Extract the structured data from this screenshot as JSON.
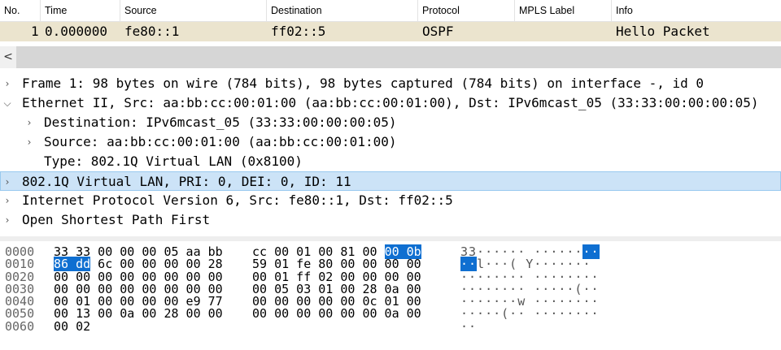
{
  "packet_list": {
    "columns": [
      "No.",
      "Time",
      "Source",
      "Destination",
      "Protocol",
      "MPLS Label",
      "Info"
    ],
    "rows": [
      {
        "no": "1",
        "time": "0.000000",
        "source": "fe80::1",
        "destination": "ff02::5",
        "protocol": "OSPF",
        "mpls_label": "",
        "info": "Hello Packet"
      }
    ]
  },
  "scrollbar": {
    "left_arrow": "<"
  },
  "details": [
    {
      "toggle": ">",
      "text": "Frame 1: 98 bytes on wire (784 bits), 98 bytes captured (784 bits) on interface -, id 0"
    },
    {
      "toggle": "v",
      "text": "Ethernet II, Src: aa:bb:cc:00:01:00 (aa:bb:cc:00:01:00), Dst: IPv6mcast_05 (33:33:00:00:00:05)"
    },
    {
      "toggle": ">",
      "text": "Destination: IPv6mcast_05 (33:33:00:00:00:05)"
    },
    {
      "toggle": ">",
      "text": "Source: aa:bb:cc:00:01:00 (aa:bb:cc:00:01:00)"
    },
    {
      "toggle": "",
      "text": "Type: 802.1Q Virtual LAN (0x8100)"
    },
    {
      "toggle": ">",
      "text": "802.1Q Virtual LAN, PRI: 0, DEI: 0, ID: 11"
    },
    {
      "toggle": ">",
      "text": "Internet Protocol Version 6, Src: fe80::1, Dst: ff02::5"
    },
    {
      "toggle": ">",
      "text": "Open Shortest Path First"
    }
  ],
  "bytes": [
    {
      "offset": "0000",
      "hex_a": "33 33 00 00 00 05 aa bb",
      "hex_b": "cc 00 01 00 81 00",
      "hex_b_hl": "00 0b",
      "ascii": "33······ ······",
      "ascii_hl": "··"
    },
    {
      "offset": "0010",
      "hex_a_hl": "86 dd",
      "hex_a": " 6c 00 00 00 00 28",
      "hex_b": "59 01 fe 80 00 00 00 00",
      "ascii_hl": "··",
      "ascii": "l···( Y·······"
    },
    {
      "offset": "0020",
      "hex_a": "00 00 00 00 00 00 00 00",
      "hex_b": "00 01 ff 02 00 00 00 00",
      "ascii": "········ ········"
    },
    {
      "offset": "0030",
      "hex_a": "00 00 00 00 00 00 00 00",
      "hex_b": "00 05 03 01 00 28 0a 00",
      "ascii": "········ ·····(··"
    },
    {
      "offset": "0040",
      "hex_a": "00 01 00 00 00 00 e9 77",
      "hex_b": "00 00 00 00 00 0c 01 00",
      "ascii": "·······w ········"
    },
    {
      "offset": "0050",
      "hex_a": "00 13 00 0a 00 28 00 00",
      "hex_b": "00 00 00 00 00 00 0a 00",
      "ascii": "·····(·· ········"
    },
    {
      "offset": "0060",
      "hex_a": "00 02",
      "hex_b": "",
      "ascii": "··"
    }
  ]
}
